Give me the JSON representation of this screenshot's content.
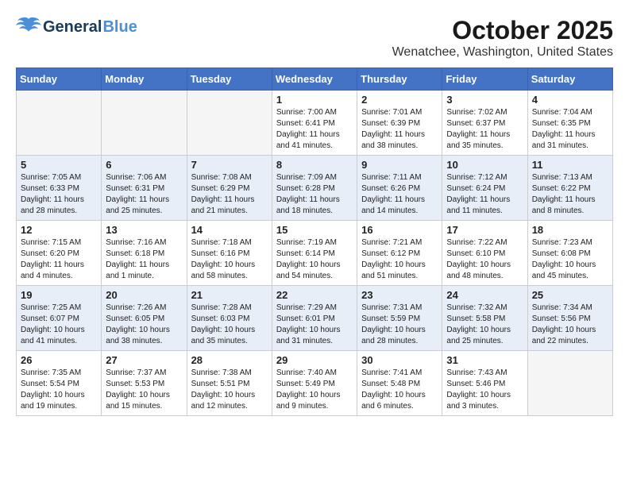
{
  "logo": {
    "part1": "General",
    "part2": "Blue"
  },
  "title": "October 2025",
  "subtitle": "Wenatchee, Washington, United States",
  "weekdays": [
    "Sunday",
    "Monday",
    "Tuesday",
    "Wednesday",
    "Thursday",
    "Friday",
    "Saturday"
  ],
  "weeks": [
    [
      {
        "day": "",
        "info": ""
      },
      {
        "day": "",
        "info": ""
      },
      {
        "day": "",
        "info": ""
      },
      {
        "day": "1",
        "info": "Sunrise: 7:00 AM\nSunset: 6:41 PM\nDaylight: 11 hours\nand 41 minutes."
      },
      {
        "day": "2",
        "info": "Sunrise: 7:01 AM\nSunset: 6:39 PM\nDaylight: 11 hours\nand 38 minutes."
      },
      {
        "day": "3",
        "info": "Sunrise: 7:02 AM\nSunset: 6:37 PM\nDaylight: 11 hours\nand 35 minutes."
      },
      {
        "day": "4",
        "info": "Sunrise: 7:04 AM\nSunset: 6:35 PM\nDaylight: 11 hours\nand 31 minutes."
      }
    ],
    [
      {
        "day": "5",
        "info": "Sunrise: 7:05 AM\nSunset: 6:33 PM\nDaylight: 11 hours\nand 28 minutes."
      },
      {
        "day": "6",
        "info": "Sunrise: 7:06 AM\nSunset: 6:31 PM\nDaylight: 11 hours\nand 25 minutes."
      },
      {
        "day": "7",
        "info": "Sunrise: 7:08 AM\nSunset: 6:29 PM\nDaylight: 11 hours\nand 21 minutes."
      },
      {
        "day": "8",
        "info": "Sunrise: 7:09 AM\nSunset: 6:28 PM\nDaylight: 11 hours\nand 18 minutes."
      },
      {
        "day": "9",
        "info": "Sunrise: 7:11 AM\nSunset: 6:26 PM\nDaylight: 11 hours\nand 14 minutes."
      },
      {
        "day": "10",
        "info": "Sunrise: 7:12 AM\nSunset: 6:24 PM\nDaylight: 11 hours\nand 11 minutes."
      },
      {
        "day": "11",
        "info": "Sunrise: 7:13 AM\nSunset: 6:22 PM\nDaylight: 11 hours\nand 8 minutes."
      }
    ],
    [
      {
        "day": "12",
        "info": "Sunrise: 7:15 AM\nSunset: 6:20 PM\nDaylight: 11 hours\nand 4 minutes."
      },
      {
        "day": "13",
        "info": "Sunrise: 7:16 AM\nSunset: 6:18 PM\nDaylight: 11 hours\nand 1 minute."
      },
      {
        "day": "14",
        "info": "Sunrise: 7:18 AM\nSunset: 6:16 PM\nDaylight: 10 hours\nand 58 minutes."
      },
      {
        "day": "15",
        "info": "Sunrise: 7:19 AM\nSunset: 6:14 PM\nDaylight: 10 hours\nand 54 minutes."
      },
      {
        "day": "16",
        "info": "Sunrise: 7:21 AM\nSunset: 6:12 PM\nDaylight: 10 hours\nand 51 minutes."
      },
      {
        "day": "17",
        "info": "Sunrise: 7:22 AM\nSunset: 6:10 PM\nDaylight: 10 hours\nand 48 minutes."
      },
      {
        "day": "18",
        "info": "Sunrise: 7:23 AM\nSunset: 6:08 PM\nDaylight: 10 hours\nand 45 minutes."
      }
    ],
    [
      {
        "day": "19",
        "info": "Sunrise: 7:25 AM\nSunset: 6:07 PM\nDaylight: 10 hours\nand 41 minutes."
      },
      {
        "day": "20",
        "info": "Sunrise: 7:26 AM\nSunset: 6:05 PM\nDaylight: 10 hours\nand 38 minutes."
      },
      {
        "day": "21",
        "info": "Sunrise: 7:28 AM\nSunset: 6:03 PM\nDaylight: 10 hours\nand 35 minutes."
      },
      {
        "day": "22",
        "info": "Sunrise: 7:29 AM\nSunset: 6:01 PM\nDaylight: 10 hours\nand 31 minutes."
      },
      {
        "day": "23",
        "info": "Sunrise: 7:31 AM\nSunset: 5:59 PM\nDaylight: 10 hours\nand 28 minutes."
      },
      {
        "day": "24",
        "info": "Sunrise: 7:32 AM\nSunset: 5:58 PM\nDaylight: 10 hours\nand 25 minutes."
      },
      {
        "day": "25",
        "info": "Sunrise: 7:34 AM\nSunset: 5:56 PM\nDaylight: 10 hours\nand 22 minutes."
      }
    ],
    [
      {
        "day": "26",
        "info": "Sunrise: 7:35 AM\nSunset: 5:54 PM\nDaylight: 10 hours\nand 19 minutes."
      },
      {
        "day": "27",
        "info": "Sunrise: 7:37 AM\nSunset: 5:53 PM\nDaylight: 10 hours\nand 15 minutes."
      },
      {
        "day": "28",
        "info": "Sunrise: 7:38 AM\nSunset: 5:51 PM\nDaylight: 10 hours\nand 12 minutes."
      },
      {
        "day": "29",
        "info": "Sunrise: 7:40 AM\nSunset: 5:49 PM\nDaylight: 10 hours\nand 9 minutes."
      },
      {
        "day": "30",
        "info": "Sunrise: 7:41 AM\nSunset: 5:48 PM\nDaylight: 10 hours\nand 6 minutes."
      },
      {
        "day": "31",
        "info": "Sunrise: 7:43 AM\nSunset: 5:46 PM\nDaylight: 10 hours\nand 3 minutes."
      },
      {
        "day": "",
        "info": ""
      }
    ]
  ]
}
